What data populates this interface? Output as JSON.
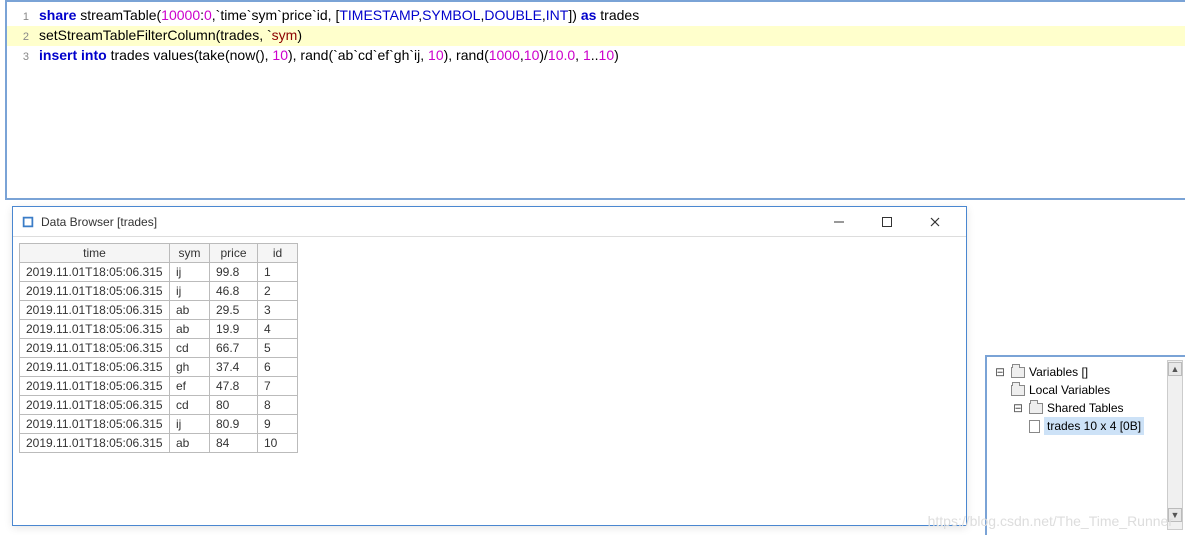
{
  "editor": {
    "lines": [
      {
        "n": "1",
        "hl": false,
        "tokens": [
          {
            "t": "share ",
            "c": "kw"
          },
          {
            "t": "streamTable(",
            "c": "plain"
          },
          {
            "t": "10000",
            "c": "num"
          },
          {
            "t": ":",
            "c": "plain"
          },
          {
            "t": "0",
            "c": "num"
          },
          {
            "t": ",`time`sym`price`id, [",
            "c": "plain"
          },
          {
            "t": "TIMESTAMP",
            "c": "type"
          },
          {
            "t": ",",
            "c": "plain"
          },
          {
            "t": "SYMBOL",
            "c": "type"
          },
          {
            "t": ",",
            "c": "plain"
          },
          {
            "t": "DOUBLE",
            "c": "type"
          },
          {
            "t": ",",
            "c": "plain"
          },
          {
            "t": "INT",
            "c": "type"
          },
          {
            "t": "]) ",
            "c": "plain"
          },
          {
            "t": "as",
            "c": "kw"
          },
          {
            "t": " trades",
            "c": "plain"
          }
        ]
      },
      {
        "n": "2",
        "hl": true,
        "tokens": [
          {
            "t": "setStreamTableFilterColumn(trades, `",
            "c": "plain"
          },
          {
            "t": "sym",
            "c": "str"
          },
          {
            "t": ")",
            "c": "plain"
          }
        ]
      },
      {
        "n": "3",
        "hl": false,
        "tokens": [
          {
            "t": "insert into ",
            "c": "kw"
          },
          {
            "t": "trades values(take(now(), ",
            "c": "plain"
          },
          {
            "t": "10",
            "c": "num"
          },
          {
            "t": "), rand(`ab`cd`ef`gh`ij, ",
            "c": "plain"
          },
          {
            "t": "10",
            "c": "num"
          },
          {
            "t": "), rand(",
            "c": "plain"
          },
          {
            "t": "1000",
            "c": "num"
          },
          {
            "t": ",",
            "c": "plain"
          },
          {
            "t": "10",
            "c": "num"
          },
          {
            "t": ")/",
            "c": "plain"
          },
          {
            "t": "10.0",
            "c": "num"
          },
          {
            "t": ", ",
            "c": "plain"
          },
          {
            "t": "1",
            "c": "num"
          },
          {
            "t": "..",
            "c": "plain"
          },
          {
            "t": "10",
            "c": "num"
          },
          {
            "t": ")",
            "c": "plain"
          }
        ]
      }
    ]
  },
  "dataBrowser": {
    "title": "Data Browser [trades]",
    "columns": [
      "time",
      "sym",
      "price",
      "id"
    ],
    "rows": [
      {
        "time": "2019.11.01T18:05:06.315",
        "sym": "ij",
        "price": "99.8",
        "id": "1"
      },
      {
        "time": "2019.11.01T18:05:06.315",
        "sym": "ij",
        "price": "46.8",
        "id": "2"
      },
      {
        "time": "2019.11.01T18:05:06.315",
        "sym": "ab",
        "price": "29.5",
        "id": "3"
      },
      {
        "time": "2019.11.01T18:05:06.315",
        "sym": "ab",
        "price": "19.9",
        "id": "4"
      },
      {
        "time": "2019.11.01T18:05:06.315",
        "sym": "cd",
        "price": "66.7",
        "id": "5"
      },
      {
        "time": "2019.11.01T18:05:06.315",
        "sym": "gh",
        "price": "37.4",
        "id": "6"
      },
      {
        "time": "2019.11.01T18:05:06.315",
        "sym": "ef",
        "price": "47.8",
        "id": "7"
      },
      {
        "time": "2019.11.01T18:05:06.315",
        "sym": "cd",
        "price": "80",
        "id": "8"
      },
      {
        "time": "2019.11.01T18:05:06.315",
        "sym": "ij",
        "price": "80.9",
        "id": "9"
      },
      {
        "time": "2019.11.01T18:05:06.315",
        "sym": "ab",
        "price": "84",
        "id": "10"
      }
    ]
  },
  "variablesPanel": {
    "root": "Variables []",
    "localVariables": "Local Variables",
    "sharedTables": "Shared Tables",
    "tradesEntry": "trades 10 x 4 [0B]"
  },
  "watermark": "https://blog.csdn.net/The_Time_Runner"
}
